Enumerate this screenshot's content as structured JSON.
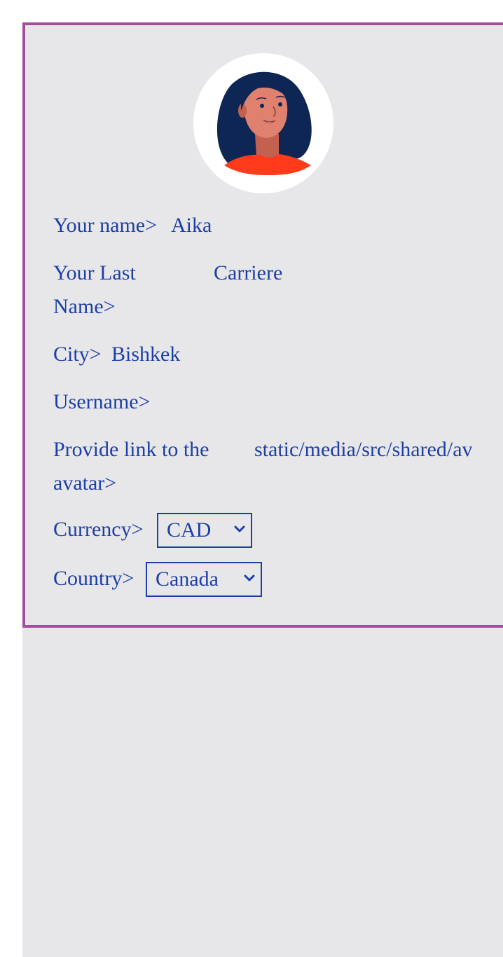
{
  "profile": {
    "avatar_icon": "woman-avatar-icon",
    "fields": {
      "first_name": {
        "label": "Your name>",
        "value": "Aika"
      },
      "last_name": {
        "label": "Your Last Name>",
        "value": "Carriere"
      },
      "city": {
        "label": "City>",
        "value": "Bishkek"
      },
      "username": {
        "label": "Username>",
        "value": ""
      },
      "avatar_link": {
        "label": "Provide link to the avatar>",
        "value": "static/media/src/shared/avatar"
      }
    },
    "currency": {
      "label": "Currency>",
      "selected": "CAD"
    },
    "country": {
      "label": "Country>",
      "selected": "Canada"
    }
  },
  "colors": {
    "text": "#1d3fa6",
    "card_border": "#a0509a",
    "background": "#e7e7ea",
    "avatar_hair": "#0d2653",
    "avatar_skin": "#e08170",
    "avatar_shirt": "#ff3b1c"
  }
}
